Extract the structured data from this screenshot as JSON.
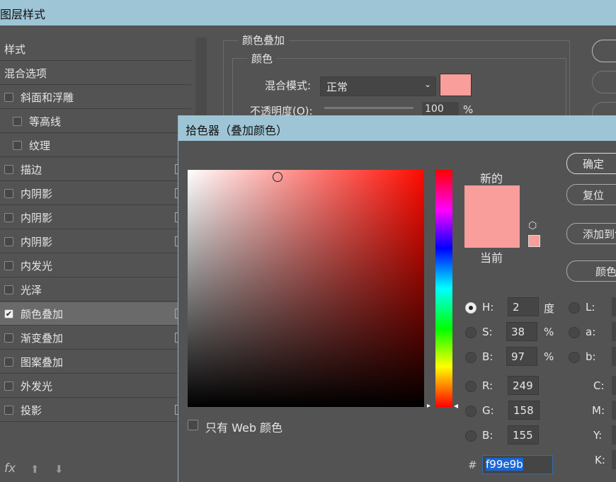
{
  "window": {
    "title": "图层样式"
  },
  "sidebar": {
    "items": [
      {
        "label": "样式",
        "checkbox": false,
        "checked": false,
        "indent": false,
        "plus": false
      },
      {
        "label": "混合选项",
        "checkbox": false,
        "checked": false,
        "indent": false,
        "plus": false
      },
      {
        "label": "斜面和浮雕",
        "checkbox": true,
        "checked": false,
        "indent": false,
        "plus": false
      },
      {
        "label": "等高线",
        "checkbox": true,
        "checked": false,
        "indent": true,
        "plus": false
      },
      {
        "label": "纹理",
        "checkbox": true,
        "checked": false,
        "indent": true,
        "plus": false
      },
      {
        "label": "描边",
        "checkbox": true,
        "checked": false,
        "indent": false,
        "plus": true
      },
      {
        "label": "内阴影",
        "checkbox": true,
        "checked": false,
        "indent": false,
        "plus": true
      },
      {
        "label": "内阴影",
        "checkbox": true,
        "checked": false,
        "indent": false,
        "plus": true
      },
      {
        "label": "内阴影",
        "checkbox": true,
        "checked": false,
        "indent": false,
        "plus": true
      },
      {
        "label": "内发光",
        "checkbox": true,
        "checked": false,
        "indent": false,
        "plus": false
      },
      {
        "label": "光泽",
        "checkbox": true,
        "checked": false,
        "indent": false,
        "plus": false
      },
      {
        "label": "颜色叠加",
        "checkbox": true,
        "checked": true,
        "indent": false,
        "plus": true,
        "selected": true
      },
      {
        "label": "渐变叠加",
        "checkbox": true,
        "checked": false,
        "indent": false,
        "plus": true
      },
      {
        "label": "图案叠加",
        "checkbox": true,
        "checked": false,
        "indent": false,
        "plus": false
      },
      {
        "label": "外发光",
        "checkbox": true,
        "checked": false,
        "indent": false,
        "plus": false
      },
      {
        "label": "投影",
        "checkbox": true,
        "checked": false,
        "indent": false,
        "plus": true
      }
    ],
    "footer": {
      "fx_label": "fx",
      "up_icon": "arrow-up-icon",
      "down_icon": "arrow-down-icon"
    }
  },
  "overlay": {
    "group_title": "颜色叠加",
    "sub_title": "颜色",
    "blend_label": "混合模式:",
    "blend_value": "正常",
    "opacity_label": "不透明度(O):",
    "opacity_value": "100",
    "opacity_unit": "%",
    "color": "#f99e9b"
  },
  "picker": {
    "title": "拾色器（叠加颜色）",
    "new_label": "新的",
    "current_label": "当前",
    "new_color": "#f99e9b",
    "current_color": "#f99e9b",
    "hue": 2,
    "web_only_label": "只有 Web 颜色",
    "buttons": {
      "ok": "确定",
      "reset": "复位",
      "add_swatch": "添加到色板",
      "color_lib": "颜色库"
    },
    "hsb": {
      "h_label": "H:",
      "h": "2",
      "h_unit": "度",
      "s_label": "S:",
      "s": "38",
      "s_unit": "%",
      "b_label": "B:",
      "b": "97",
      "b_unit": "%"
    },
    "rgb": {
      "r_label": "R:",
      "r": "249",
      "g_label": "G:",
      "g": "158",
      "b_label": "B:",
      "b": "155"
    },
    "lab": {
      "l_label": "L:",
      "a_label": "a:",
      "b_label": "b:"
    },
    "cmyk": {
      "c_label": "C:",
      "m_label": "M:",
      "y_label": "Y:",
      "k_label": "K:"
    },
    "hex_label": "#",
    "hex": "f99e9b"
  }
}
